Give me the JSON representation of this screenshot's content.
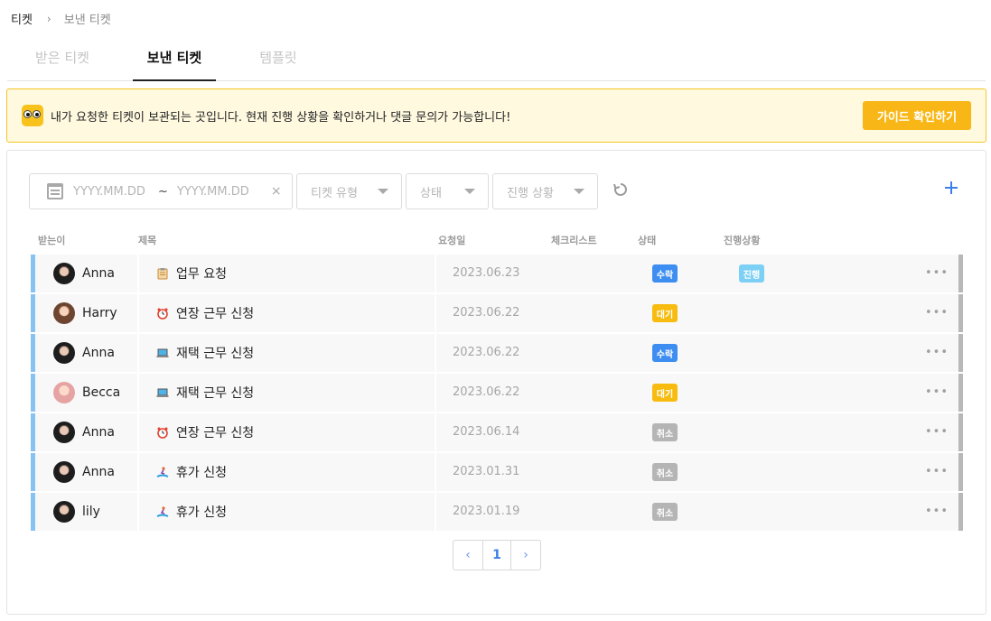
{
  "breadcrumb": {
    "root": "티켓",
    "current": "보낸 티켓"
  },
  "tabs": [
    {
      "label": "받은 티켓",
      "active": false
    },
    {
      "label": "보낸 티켓",
      "active": true
    },
    {
      "label": "템플릿",
      "active": false
    }
  ],
  "notice": {
    "text": "내가 요청한 티켓이 보관되는 곳입니다. 현재 진행 상황을 확인하거나 댓글 문의가 가능합니다!",
    "button": "가이드 확인하기"
  },
  "filters": {
    "date_start_placeholder": "YYYY.MM.DD",
    "date_sep": "~",
    "date_end_placeholder": "YYYY.MM.DD",
    "clear": "×",
    "ticket_type": "티켓 유형",
    "status": "상태",
    "progress": "진행 상황"
  },
  "table": {
    "headers": {
      "receiver": "받는이",
      "title": "제목",
      "request_date": "요청일",
      "checklist": "체크리스트",
      "status": "상태",
      "progress": "진행상황"
    },
    "rows": [
      {
        "receiver": "Anna",
        "avatar": "dark",
        "icon": "clipboard-icon",
        "title": "업무 요청",
        "date": "2023.06.23",
        "status": "수락",
        "status_color": "#3e8ef2",
        "progress": "진행",
        "progress_color": "#7dd0f5",
        "more": "•••"
      },
      {
        "receiver": "Harry",
        "avatar": "brown",
        "icon": "alarm-clock-icon",
        "title": "연장 근무 신청",
        "date": "2023.06.22",
        "status": "대기",
        "status_color": "#f7bc0f",
        "progress": "",
        "more": "•••"
      },
      {
        "receiver": "Anna",
        "avatar": "dark",
        "icon": "laptop-icon",
        "title": "재택 근무 신청",
        "date": "2023.06.22",
        "status": "수락",
        "status_color": "#3e8ef2",
        "progress": "",
        "more": "•••"
      },
      {
        "receiver": "Becca",
        "avatar": "pink",
        "icon": "laptop-icon",
        "title": "재택 근무 신청",
        "date": "2023.06.22",
        "status": "대기",
        "status_color": "#f7bc0f",
        "progress": "",
        "more": "•••"
      },
      {
        "receiver": "Anna",
        "avatar": "dark",
        "icon": "alarm-clock-icon",
        "title": "연장 근무 신청",
        "date": "2023.06.14",
        "status": "취소",
        "status_color": "#b5b5b5",
        "progress": "",
        "more": "•••"
      },
      {
        "receiver": "Anna",
        "avatar": "dark",
        "icon": "surfer-icon",
        "title": "휴가 신청",
        "date": "2023.01.31",
        "status": "취소",
        "status_color": "#b5b5b5",
        "progress": "",
        "more": "•••"
      },
      {
        "receiver": "lily",
        "avatar": "dark",
        "icon": "surfer-icon",
        "title": "휴가 신청",
        "date": "2023.01.19",
        "status": "취소",
        "status_color": "#b5b5b5",
        "progress": "",
        "more": "•••"
      }
    ]
  },
  "pagination": {
    "prev": "‹",
    "current": "1",
    "next": "›"
  },
  "colors": {
    "accent": "#3c7fe8",
    "notice_bg": "#fff9e0",
    "notice_border": "#f6c624",
    "guide_button": "#f8b716",
    "row_left_bar": "#86c2f2"
  }
}
